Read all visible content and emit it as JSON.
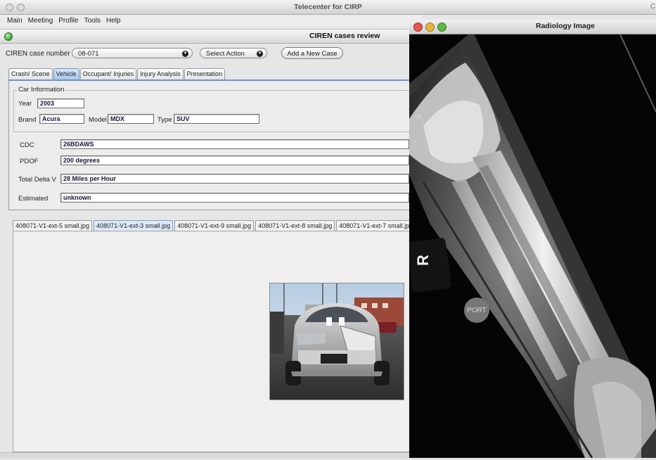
{
  "window": {
    "title": "Telecenter for CIRP",
    "edge_char": "C"
  },
  "menu": [
    "Main",
    "Meeting",
    "Profile",
    "Tools",
    "Help"
  ],
  "inner_window": {
    "title": "CIREN cases review"
  },
  "toolbar": {
    "case_number_label": "CIREN case number",
    "case_number_value": "08-071",
    "select_action_label": "Select Action",
    "add_case_label": "Add a New Case"
  },
  "tabs": [
    {
      "label": "Crash/ Scene",
      "active": false
    },
    {
      "label": "Vehicle",
      "active": true
    },
    {
      "label": "Occupant/ Injuries",
      "active": false
    },
    {
      "label": "Injury Analysis",
      "active": false
    },
    {
      "label": "Presentation",
      "active": false
    }
  ],
  "car_info": {
    "legend": "Car Information",
    "year_label": "Year",
    "year": "2003",
    "brand_label": "Brand",
    "brand": "Acura",
    "model_label": "Model",
    "model": "MDX",
    "type_label": "Type",
    "type": "SUV",
    "cdc_label": "CDC",
    "cdc": "26BDAWS",
    "pdof_label": "PDOF",
    "pdof": "200 degrees",
    "delta_v_label": "Total Delta V",
    "delta_v": "28 Miles per Hour",
    "estimated_label": "Estimated",
    "estimated": "unknown"
  },
  "image_tabs": [
    {
      "label": "408071-V1-ext-5 small.jpg",
      "active": false
    },
    {
      "label": "408071-V1-ext-3 small.jpg",
      "active": true
    },
    {
      "label": "408071-V1-ext-9 small.jpg",
      "active": false
    },
    {
      "label": "408071-V1-ext-8 small.jpg",
      "active": false
    },
    {
      "label": "408071-V1-ext-7 small.jp",
      "active": false
    }
  ],
  "radiology": {
    "title": "Radiology Image",
    "marker_r": "R",
    "marker_port": "PORT"
  },
  "colors": {
    "accent_tab": "#a9c8ef",
    "close": "#e5544e",
    "minimize": "#e9b43c",
    "zoom": "#58b848"
  }
}
